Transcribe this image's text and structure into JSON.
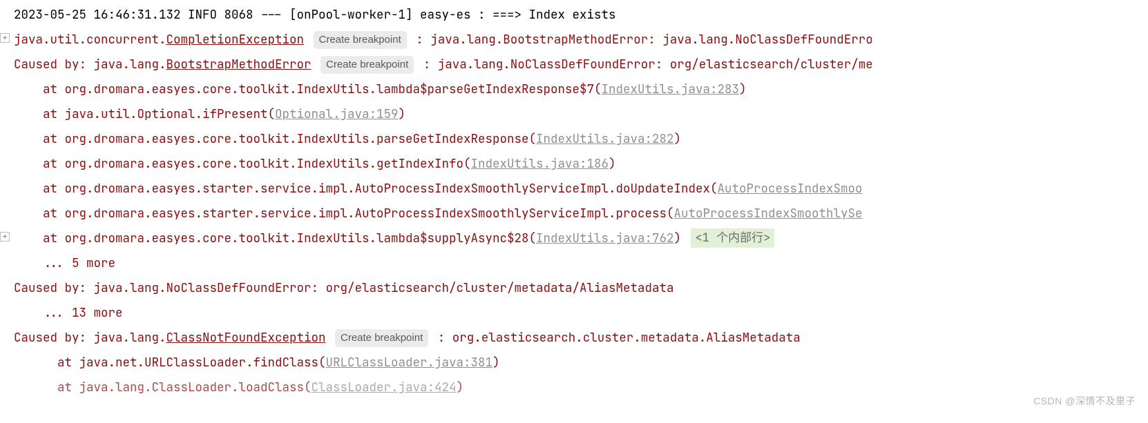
{
  "bp_label": "Create breakpoint",
  "l0": "2023-05-25 16:46:31.132  INFO 8068 --- [onPool-worker-1] easy-es                                                    : ===> Index exists",
  "l1a": "java.util.concurrent.",
  "l1b": "CompletionException",
  "l1c": ": java.lang.BootstrapMethodError: java.lang.NoClassDefFoundErro",
  "l2a": "Caused by: java.lang.",
  "l2b": "BootstrapMethodError",
  "l2c": ": java.lang.NoClassDefFoundError: org/elasticsearch/cluster/me",
  "l3a": "at org.dromara.easyes.core.toolkit.IndexUtils.lambda$parseGetIndexResponse$7(",
  "l3b": "IndexUtils.java:283",
  "l3c": ")",
  "l4a": "at java.util.Optional.ifPresent(",
  "l4b": "Optional.java:159",
  "l4c": ")",
  "l5a": "at org.dromara.easyes.core.toolkit.IndexUtils.parseGetIndexResponse(",
  "l5b": "IndexUtils.java:282",
  "l5c": ")",
  "l6a": "at org.dromara.easyes.core.toolkit.IndexUtils.getIndexInfo(",
  "l6b": "IndexUtils.java:186",
  "l6c": ")",
  "l7a": "at org.dromara.easyes.starter.service.impl.AutoProcessIndexSmoothlyServiceImpl.doUpdateIndex(",
  "l7b": "AutoProcessIndexSmoo",
  "l8a": "at org.dromara.easyes.starter.service.impl.AutoProcessIndexSmoothlyServiceImpl.process(",
  "l8b": "AutoProcessIndexSmoothlySe",
  "l9a": "at org.dromara.easyes.core.toolkit.IndexUtils.lambda$supplyAsync$28(",
  "l9b": "IndexUtils.java:762",
  "l9c": ")",
  "l9hint": "<1 个内部行>",
  "l10": "... 5 more",
  "l11": "Caused by: java.lang.NoClassDefFoundError: org/elasticsearch/cluster/metadata/AliasMetadata",
  "l12": "... 13 more",
  "l13a": "Caused by: java.lang.",
  "l13b": "ClassNotFoundException",
  "l13c": ": org.elasticsearch.cluster.metadata.AliasMetadata",
  "l14a": "at java.net.URLClassLoader.findClass(",
  "l14b": "URLClassLoader.java:381",
  "l14c": ")",
  "l15a": "at java.lang.ClassLoader.loadClass(",
  "l15b": "ClassLoader.java:424",
  "l15c": ")",
  "watermark": "CSDN @深情不及里子"
}
